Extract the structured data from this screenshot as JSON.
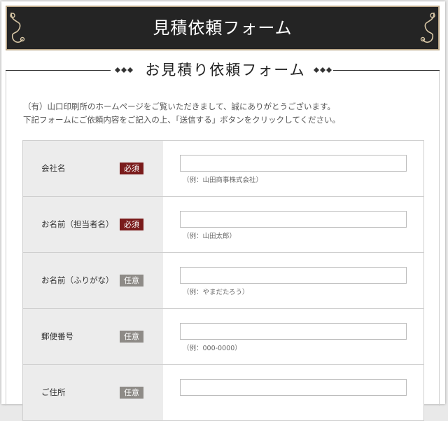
{
  "header": {
    "title": "見積依頼フォーム"
  },
  "section": {
    "title": "お見積り依頼フォーム"
  },
  "intro": {
    "line1": "（有）山口印刷所のホームページをご覧いただきまして、誠にありがとうございます。",
    "line2": "下記フォームにご依頼内容をご記入の上、「送信する」ボタンをクリックしてください。"
  },
  "fields": [
    {
      "label": "会社名",
      "badge": "必須",
      "value": "",
      "example": "（例：山田商事株式会社）"
    },
    {
      "label": "お名前（担当者名）",
      "badge": "必須",
      "value": "",
      "example": "（例：山田太郎）"
    },
    {
      "label": "お名前（ふりがな）",
      "badge": "任意",
      "value": "",
      "example": "（例：やまだたろう）"
    },
    {
      "label": "郵便番号",
      "badge": "任意",
      "value": "",
      "example": "（例：000-0000）"
    },
    {
      "label": "ご住所",
      "badge": "任意",
      "value": "",
      "example": ""
    }
  ],
  "colors": {
    "header_bg": "#242424",
    "header_border": "#bda98a",
    "required_badge": "#7a1b1b",
    "optional_badge": "#8e8b87",
    "label_bg": "#ececec"
  }
}
